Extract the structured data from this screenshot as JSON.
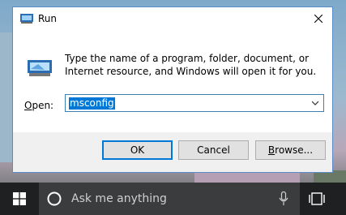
{
  "dialog": {
    "title": "Run",
    "description": "Type the name of a program, folder, document, or Internet resource, and Windows will open it for you.",
    "open_label_prefix": "O",
    "open_label_rest": "pen:",
    "input_value": "msconfig",
    "buttons": {
      "ok": "OK",
      "cancel": "Cancel",
      "browse_prefix": "B",
      "browse_rest": "rowse..."
    },
    "accent": "#0078d7"
  },
  "taskbar": {
    "search_placeholder": "Ask me anything",
    "icons": [
      "windows-start-icon",
      "cortana-icon",
      "microphone-icon",
      "task-view-icon"
    ]
  }
}
